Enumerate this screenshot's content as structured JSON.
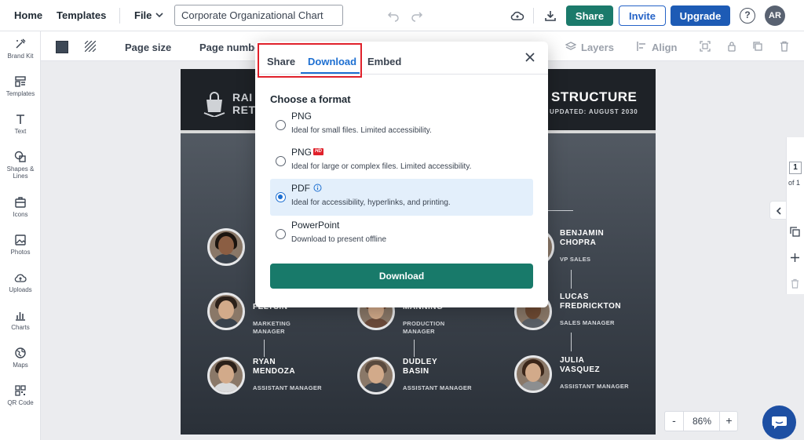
{
  "topbar": {
    "home": "Home",
    "templates": "Templates",
    "file": "File",
    "document_title": "Corporate Organizational Chart",
    "share": "Share",
    "invite": "Invite",
    "upgrade": "Upgrade",
    "help": "?",
    "avatar": "AR"
  },
  "sidebar": {
    "items": [
      {
        "label": "Brand Kit",
        "icon": "brand-kit-icon"
      },
      {
        "label": "Templates",
        "icon": "templates-icon"
      },
      {
        "label": "Text",
        "icon": "text-icon"
      },
      {
        "label": "Shapes &",
        "label2": "Lines",
        "icon": "shapes-icon"
      },
      {
        "label": "Icons",
        "icon": "icons-icon"
      },
      {
        "label": "Photos",
        "icon": "photos-icon"
      },
      {
        "label": "Uploads",
        "icon": "uploads-icon"
      },
      {
        "label": "Charts",
        "icon": "charts-icon"
      },
      {
        "label": "Maps",
        "icon": "maps-icon"
      },
      {
        "label": "QR Code",
        "icon": "qr-code-icon"
      }
    ]
  },
  "subbar": {
    "page_size": "Page size",
    "page_number": "Page numbe",
    "layers": "Layers",
    "align": "Align"
  },
  "canvas": {
    "brand_line1": "RAI",
    "brand_line2": "RET",
    "title": "STRUCTURE",
    "subtitle": "UPDATED: AUGUST 2030",
    "people": [
      {
        "name1": "BENJAMIN",
        "name2": "CHOPRA",
        "role": "VP SALES"
      },
      {
        "name1": "",
        "name2": "FELTSIN",
        "role": "MARKETING",
        "role2": "MANAGER"
      },
      {
        "name1": "",
        "name2": "MANNING",
        "role": "PRODUCTION",
        "role2": "MANAGER"
      },
      {
        "name1": "LUCAS",
        "name2": "FREDRICKTON",
        "role": "SALES MANAGER"
      },
      {
        "name1": "RYAN",
        "name2": "MENDOZA",
        "role": "ASSISTANT MANAGER"
      },
      {
        "name1": "DUDLEY",
        "name2": "BASIN",
        "role": "ASSISTANT MANAGER"
      },
      {
        "name1": "JULIA",
        "name2": "VASQUEZ",
        "role": "ASSISTANT MANAGER"
      }
    ]
  },
  "pager": {
    "current": "1",
    "of": "of 1"
  },
  "zoom": {
    "minus": "-",
    "value": "86%",
    "plus": "+"
  },
  "modal": {
    "tabs": [
      {
        "label": "Share",
        "active": false
      },
      {
        "label": "Download",
        "active": true
      },
      {
        "label": "Embed",
        "active": false
      }
    ],
    "heading": "Choose a format",
    "options": [
      {
        "title": "PNG",
        "desc": "Ideal for small files. Limited accessibility.",
        "selected": false
      },
      {
        "title": "PNG",
        "badge": "HD",
        "desc": "Ideal for large or complex files. Limited accessibility.",
        "selected": false
      },
      {
        "title": "PDF",
        "desc": "Ideal for accessibility, hyperlinks, and printing.",
        "selected": true
      },
      {
        "title": "PowerPoint",
        "desc": "Download to present offline",
        "selected": false
      }
    ],
    "download_button": "Download"
  },
  "colors": {
    "accent": "#1d6fd1",
    "primary_green": "#187a6a",
    "upgrade_blue": "#1d5bb5",
    "highlight_red": "#e0212b"
  }
}
